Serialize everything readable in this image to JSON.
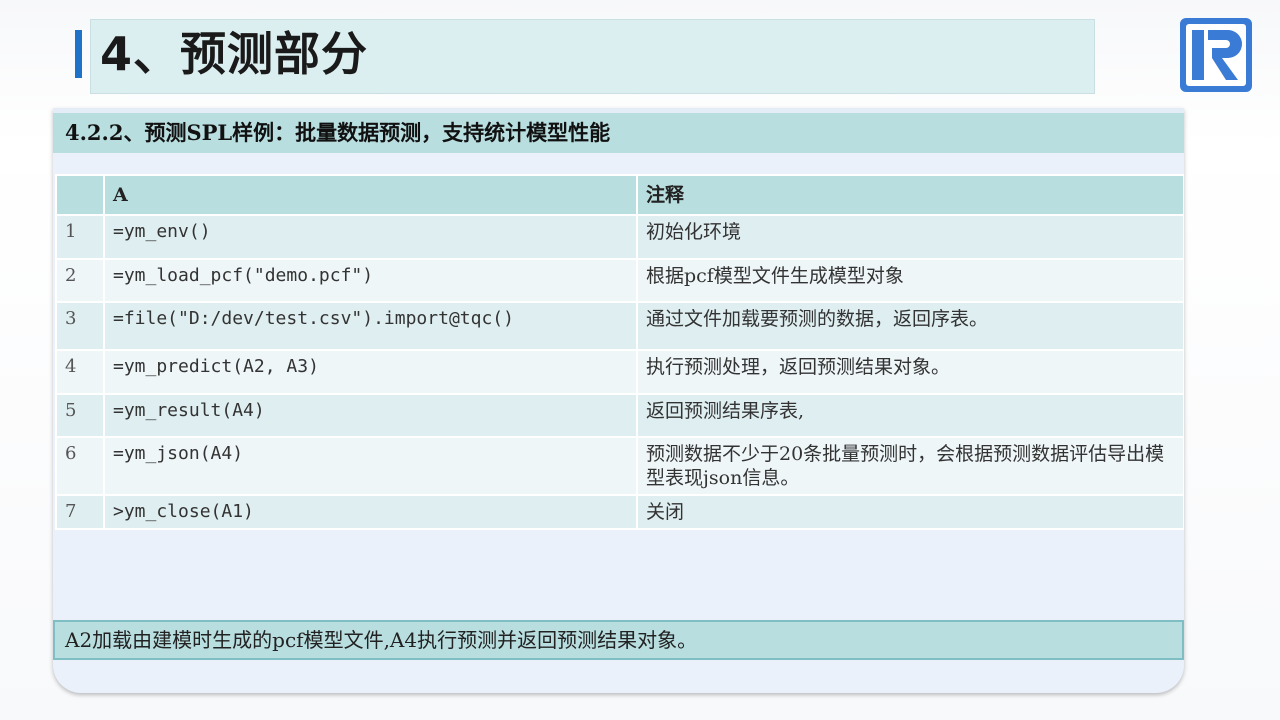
{
  "header": {
    "title": "4、预测部分"
  },
  "logo": {
    "icon": "r-logo-icon",
    "color": "#3a7bd5"
  },
  "section": {
    "subtitle": "4.2.2、预测SPL样例：批量数据预测，支持统计模型性能"
  },
  "table": {
    "headers": {
      "index": "",
      "code": "A",
      "note": "注释"
    },
    "rows": [
      {
        "num": "1",
        "code": "=ym_env()",
        "note": "初始化环境"
      },
      {
        "num": "2",
        "code": "=ym_load_pcf(\"demo.pcf\")",
        "note": "根据pcf模型文件生成模型对象"
      },
      {
        "num": "3",
        "code": "=file(\"D:/dev/test.csv\").import@tqc()",
        "note": "通过文件加载要预测的数据，返回序表。"
      },
      {
        "num": "4",
        "code": "=ym_predict(A2, A3)",
        "note": "执行预测处理，返回预测结果对象。"
      },
      {
        "num": "5",
        "code": "=ym_result(A4)",
        "note": "返回预测结果序表,"
      },
      {
        "num": "6",
        "code": "=ym_json(A4)",
        "note": "预测数据不少于20条批量预测时，会根据预测数据评估导出模型表现json信息。"
      },
      {
        "num": "7",
        "code": ">ym_close(A1)",
        "note": "关闭"
      }
    ]
  },
  "footnote": {
    "text": "A2加载由建模时生成的pcf模型文件,A4执行预测并返回预测结果对象。"
  },
  "colors": {
    "accent": "#1e73c8",
    "header_bg": "#b9dee0",
    "card_bg": "#eaf1fb"
  }
}
